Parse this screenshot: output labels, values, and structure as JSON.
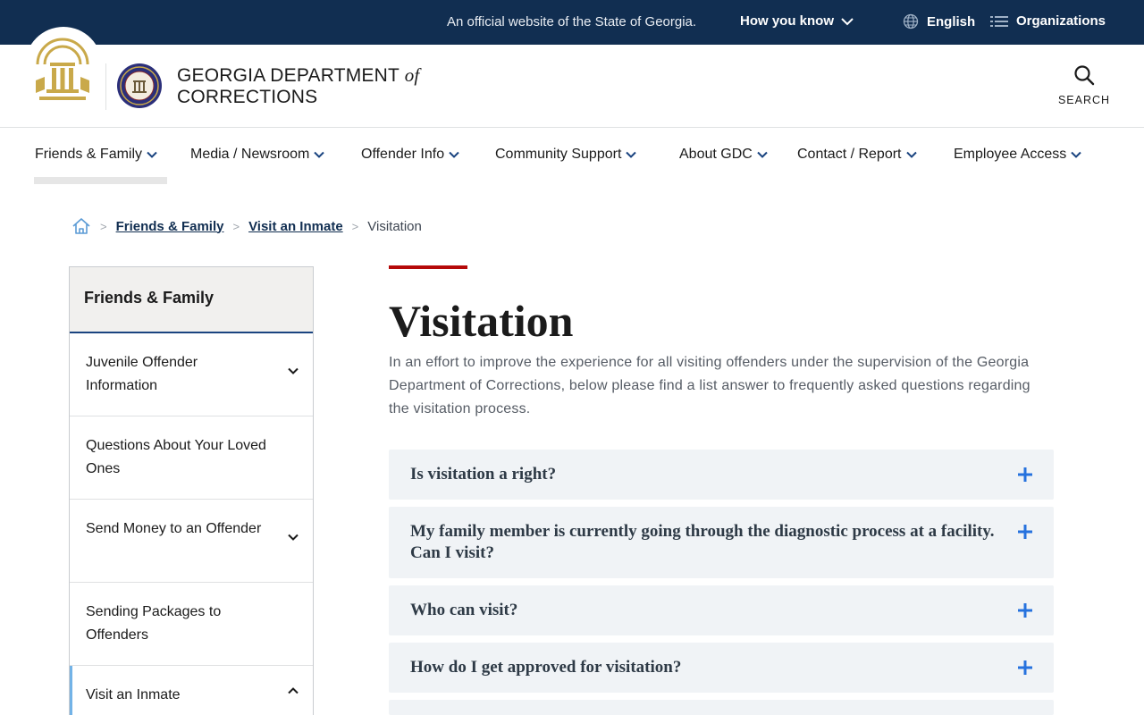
{
  "banner": {
    "official_text": "An official website of the State of Georgia.",
    "how_you_know": "How you know",
    "language": "English",
    "organizations": "Organizations"
  },
  "header": {
    "brand_line1": "GEORGIA DEPARTMENT",
    "brand_of": "of",
    "brand_line2": "CORRECTIONS",
    "search_label": "SEARCH"
  },
  "nav": {
    "items": [
      {
        "label": "Friends & Family"
      },
      {
        "label": "Media / Newsroom"
      },
      {
        "label": "Offender Info"
      },
      {
        "label": "Community Support"
      },
      {
        "label": "About GDC"
      },
      {
        "label": "Contact / Report"
      },
      {
        "label": "Employee Access"
      }
    ]
  },
  "breadcrumb": {
    "items": [
      "Friends & Family",
      "Visit an Inmate"
    ],
    "current": "Visitation"
  },
  "sidebar": {
    "heading": "Friends & Family",
    "items": [
      {
        "label": "Juvenile Offender Information",
        "expandable": true
      },
      {
        "label": "Questions About Your Loved Ones",
        "expandable": false
      },
      {
        "label": "Send Money to an Offender",
        "expandable": true
      },
      {
        "label": "Sending Packages to Offenders",
        "expandable": false
      },
      {
        "label": "Visit an Inmate",
        "expandable": true,
        "expanded": true
      }
    ]
  },
  "main": {
    "title": "Visitation",
    "intro": "In an effort to improve the experience for all visiting offenders under the supervision of the Georgia Department of Corrections, below please find a list answer to frequently asked questions regarding the visitation process.",
    "faqs": [
      {
        "question": "Is visitation a right?"
      },
      {
        "question": "My family member is currently going through the diagnostic process at a facility. Can I visit?"
      },
      {
        "question": "Who can visit?"
      },
      {
        "question": "How do I get approved for visitation?"
      }
    ]
  },
  "colors": {
    "banner_bg": "#112e51",
    "accent_red": "#b50909",
    "plus_blue": "#2672de",
    "seal_gold": "#c9a94a"
  }
}
